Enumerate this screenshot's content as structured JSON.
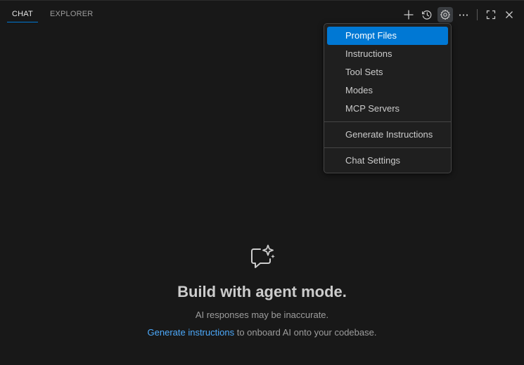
{
  "tabs": [
    {
      "label": "CHAT",
      "active": true
    },
    {
      "label": "EXPLORER",
      "active": false
    }
  ],
  "toolbar": {
    "icons": [
      "plus-icon",
      "history-icon",
      "gear-icon",
      "ellipsis-icon",
      "maximize-icon",
      "close-icon"
    ],
    "pressed": "gear-icon"
  },
  "menu": {
    "items": [
      {
        "label": "Prompt Files",
        "highlighted": true
      },
      {
        "label": "Instructions"
      },
      {
        "label": "Tool Sets"
      },
      {
        "label": "Modes"
      },
      {
        "label": "MCP Servers"
      },
      {
        "label": "Generate Instructions"
      },
      {
        "label": "Chat Settings"
      }
    ]
  },
  "welcome": {
    "title": "Build with agent mode.",
    "subtitle": "AI responses may be inaccurate.",
    "link_text": "Generate instructions",
    "link_suffix": " to onboard AI onto your codebase."
  },
  "colors": {
    "background": "#181818",
    "accent": "#0078d4",
    "link": "#4daafc",
    "menu_bg": "#1f1f1f"
  }
}
